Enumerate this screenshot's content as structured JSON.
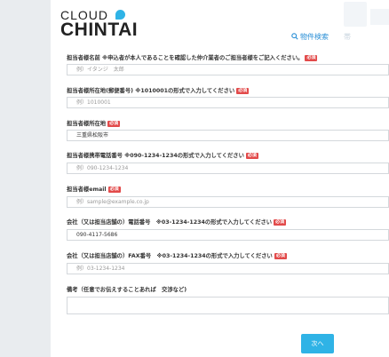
{
  "brand": {
    "line1": "CLOUD",
    "line2": "CHINTAI"
  },
  "header": {
    "search_label": "物件検索",
    "faint_text": "帯"
  },
  "fields": [
    {
      "label": "担当者様名前 ※申込者が本人であることを確認した仲介業者のご担当者様をご記入ください。",
      "required": "必須",
      "value": "",
      "placeholder": "例）イタンジ　太郎"
    },
    {
      "label": "担当者様所在地(郵便番号) ※1010001の形式で入力してください",
      "required": "必須",
      "value": "",
      "placeholder": "例）1010001"
    },
    {
      "label": "担当者様所在地",
      "required": "必須",
      "value": "三重県松阪市",
      "placeholder": ""
    },
    {
      "label": "担当者様携帯電話番号 ※090-1234-1234の形式で入力してください",
      "required": "必須",
      "value": "",
      "placeholder": "例）090-1234-1234"
    },
    {
      "label": "担当者様email",
      "required": "必須",
      "value": "",
      "placeholder": "例）sample@example.co.jp"
    },
    {
      "label": "会社（又は担当店舗の）電話番号　※03-1234-1234の形式で入力してください",
      "required": "必須",
      "value": "090-4117-5686",
      "placeholder": ""
    },
    {
      "label": "会社（又は担当店舗の）FAX番号　※03-1234-1234の形式で入力してください",
      "required": "必須",
      "value": "",
      "placeholder": "例）03-1234-1234"
    },
    {
      "label": "備考（任意でお伝えすることあれば　交渉など)",
      "required": "",
      "value": "",
      "placeholder": ""
    }
  ],
  "next_button": "次へ"
}
